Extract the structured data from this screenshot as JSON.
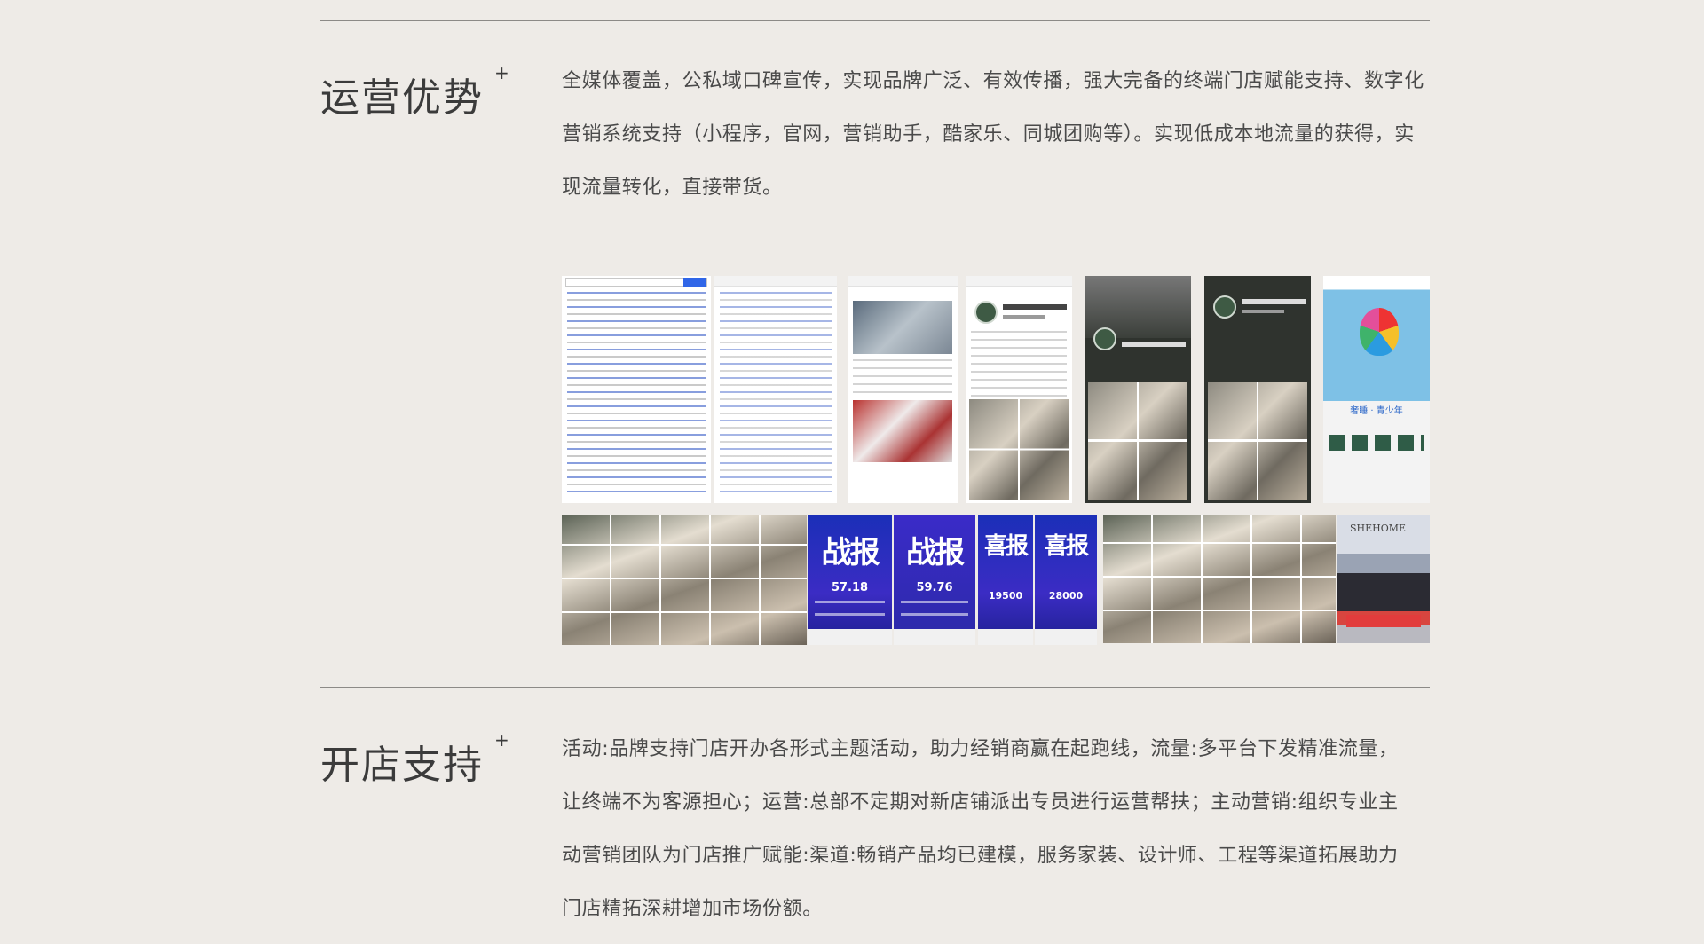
{
  "sections": [
    {
      "title": "运营优势",
      "plus": "+",
      "text": "全媒体覆盖，公私域口碑宣传，实现品牌广泛、有效传播，强大完备的终端门店赋能支持、数字化营销系统支持（小程序，官网，营销助手，酷家乐、同城团购等）。实现低成本地流量的获得，实现流量转化，直接带货。"
    },
    {
      "title": "开店支持",
      "plus": "+",
      "text": "活动:品牌支持门店开办各形式主题活动，助力经销商赢在起跑线，流量:多平台下发精准流量，让终端不为客源担心；运营:总部不定期对新店铺派出专员进行运营帮扶；主动营销:组织专业主动营销团队为门店推广赋能:渠道:畅销产品均已建模，服务家装、设计师、工程等渠道拓展助力门店精拓深耕增加市场份额。"
    }
  ],
  "gallery": {
    "posters": [
      {
        "headline": "战报",
        "figure": "57.18"
      },
      {
        "headline": "战报",
        "figure": "59.76"
      },
      {
        "headline": "喜报",
        "figure": "19500"
      },
      {
        "headline": "喜报",
        "figure": "28000"
      }
    ],
    "team_photo": {
      "brand": "SHEHOME",
      "banner": ""
    },
    "balloon_screen": {
      "tag": "奢睡 · 青少年"
    }
  }
}
